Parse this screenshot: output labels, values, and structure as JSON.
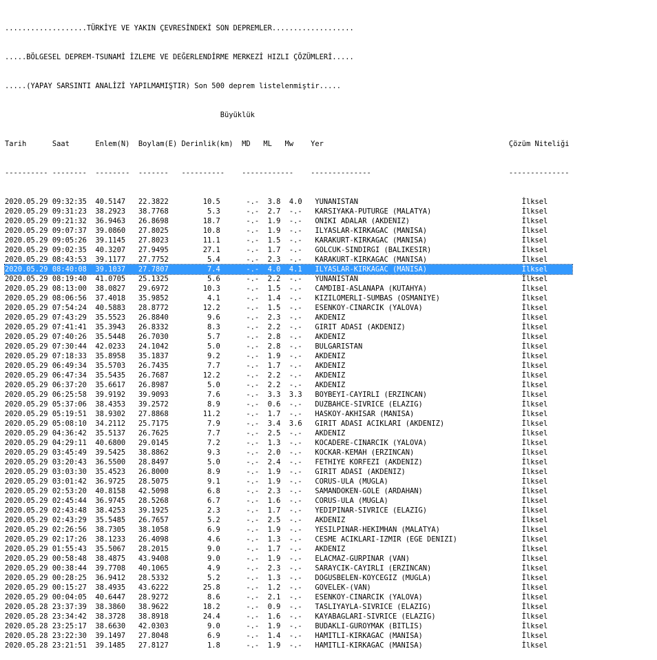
{
  "header": {
    "title_line_1": "...................TÜRKİYE VE YAKIN ÇEVRESİNDEKİ SON DEPREMLER...................",
    "title_line_2": ".....BÖLGESEL DEPREM-TSUNAMİ İZLEME VE DEĞERLENDİRME MERKEZİ HIZLI ÇÖZÜMLERİ.....",
    "title_line_3": ".....(YAPAY SARSINTI ANALİZİ YAPILMAMIŞTIR) Son 500 deprem listelenmiştir.....",
    "magnitude_group_label": "                                                  Büyüklük",
    "column_header_line": "Tarih      Saat      Enlem(N)  Boylam(E) Derinlik(km)  MD   ML   Mw    Yer                                           Çözüm Niteliği",
    "separator_line": "---------- --------  --------  -------   ----------    ------------    --------------                                --------------"
  },
  "selected_index": 7,
  "rows": [
    {
      "text": "2020.05.29 09:32:35  40.5147   22.3822        10.5      -.-  3.8  4.0   YUNANISTAN                                      İlksel"
    },
    {
      "text": "2020.05.29 09:31:23  38.2923   38.7768         5.3      -.-  2.7  -.-   KARSIYAKA-PUTURGE (MALATYA)                     İlksel"
    },
    {
      "text": "2020.05.29 09:21:32  36.9463   26.8698        18.7      -.-  1.9  -.-   ONIKI ADALAR (AKDENIZ)                          İlksel"
    },
    {
      "text": "2020.05.29 09:07:37  39.0860   27.8025        10.8      -.-  1.9  -.-   ILYASLAR-KIRKAGAC (MANISA)                      İlksel"
    },
    {
      "text": "2020.05.29 09:05:26  39.1145   27.8023        11.1      -.-  1.5  -.-   KARAKURT-KIRKAGAC (MANISA)                      İlksel"
    },
    {
      "text": "2020.05.29 09:02:35  40.3207   27.9495        27.1      -.-  1.7  -.-   GOLCUK-SINDIRGI (BALIKESIR)                     İlksel"
    },
    {
      "text": "2020.05.29 08:43:53  39.1177   27.7752         5.4      -.-  2.3  -.-   KARAKURT-KIRKAGAC (MANISA)                      İlksel"
    },
    {
      "text": "2020.05.29 08:40:08  39.1037   27.7807         7.4      -.-  4.0  4.1   ILYASLAR-KIRKAGAC (MANISA)                      İlksel"
    },
    {
      "text": "2020.05.29 08:19:40  41.0705   25.1325         5.6      -.-  2.2  -.-   YUNANISTAN                                      İlksel"
    },
    {
      "text": "2020.05.29 08:13:00  38.0827   29.6972        10.3      -.-  1.5  -.-   CAMDIBI-ASLANAPA (KUTAHYA)                      İlksel"
    },
    {
      "text": "2020.05.29 08:06:56  37.4018   35.9852         4.1      -.-  1.4  -.-   KIZILOMERLI-SUMBAS (OSMANIYE)                   İlksel"
    },
    {
      "text": "2020.05.29 07:54:24  40.5883   28.8772        12.2      -.-  1.5  -.-   ESENKOY-CINARCIK (YALOVA)                       İlksel"
    },
    {
      "text": "2020.05.29 07:43:29  35.5523   26.8840         9.6      -.-  2.3  -.-   AKDENIZ                                         İlksel"
    },
    {
      "text": "2020.05.29 07:41:41  35.3943   26.8332         8.3      -.-  2.2  -.-   GIRIT ADASI (AKDENIZ)                           İlksel"
    },
    {
      "text": "2020.05.29 07:40:26  35.5448   26.7030         5.7      -.-  2.8  -.-   AKDENIZ                                         İlksel"
    },
    {
      "text": "2020.05.29 07:30:44  42.0233   24.1042         5.0      -.-  2.8  -.-   BULGARISTAN                                     İlksel"
    },
    {
      "text": "2020.05.29 07:18:33  35.8958   35.1837         9.2      -.-  1.9  -.-   AKDENIZ                                         İlksel"
    },
    {
      "text": "2020.05.29 06:49:34  35.5703   26.7435         7.7      -.-  1.7  -.-   AKDENIZ                                         İlksel"
    },
    {
      "text": "2020.05.29 06:47:34  35.5435   26.7687        12.2      -.-  2.2  -.-   AKDENIZ                                         İlksel"
    },
    {
      "text": "2020.05.29 06:37:20  35.6617   26.8987         5.0      -.-  2.2  -.-   AKDENIZ                                         İlksel"
    },
    {
      "text": "2020.05.29 06:25:58  39.9192   39.9093         7.6      -.-  3.3  3.3   BOYBEYI-CAYIRLI (ERZINCAN)                      İlksel"
    },
    {
      "text": "2020.05.29 05:37:06  38.4353   39.2572         8.9      -.-  0.6  -.-   DUZBAHCE-SIVRICE (ELAZIG)                       İlksel"
    },
    {
      "text": "2020.05.29 05:19:51  38.9302   27.8868        11.2      -.-  1.7  -.-   HASKOY-AKHISAR (MANISA)                         İlksel"
    },
    {
      "text": "2020.05.29 05:08:10  34.2112   25.7175         7.9      -.-  3.4  3.6   GIRIT ADASI ACIKLARI (AKDENIZ)                  İlksel"
    },
    {
      "text": "2020.05.29 04:36:42  35.5137   26.7625         7.7      -.-  2.5  -.-   AKDENIZ                                         İlksel"
    },
    {
      "text": "2020.05.29 04:29:11  40.6800   29.0145         7.2      -.-  1.3  -.-   KOCADERE-CINARCIK (YALOVA)                      İlksel"
    },
    {
      "text": "2020.05.29 03:45:49  39.5425   38.8862         9.3      -.-  2.0  -.-   KOCKAR-KEMAH (ERZINCAN)                         İlksel"
    },
    {
      "text": "2020.05.29 03:20:43  36.5500   28.8497         5.0      -.-  2.4  -.-   FETHIYE KORFEZI (AKDENIZ)                       İlksel"
    },
    {
      "text": "2020.05.29 03:03:30  35.4523   26.8000         8.9      -.-  1.9  -.-   GIRIT ADASI (AKDENIZ)                           İlksel"
    },
    {
      "text": "2020.05.29 03:01:42  36.9725   28.5075         9.1      -.-  1.9  -.-   CORUS-ULA (MUGLA)                               İlksel"
    },
    {
      "text": "2020.05.29 02:53:20  40.8158   42.5098         6.8      -.-  2.3  -.-   SAMANDOKEN-GOLE (ARDAHAN)                       İlksel"
    },
    {
      "text": "2020.05.29 02:45:44  36.9745   28.5268         6.7      -.-  1.6  -.-   CORUS-ULA (MUGLA)                               İlksel"
    },
    {
      "text": "2020.05.29 02:43:48  38.4253   39.1925         2.3      -.-  1.7  -.-   YEDIPINAR-SIVRICE (ELAZIG)                      İlksel"
    },
    {
      "text": "2020.05.29 02:43:29  35.5485   26.7657         5.2      -.-  2.5  -.-   AKDENIZ                                         İlksel"
    },
    {
      "text": "2020.05.29 02:26:56  38.7305   38.1058         6.9      -.-  1.9  -.-   YESILPINAR-HEKIMHAN (MALATYA)                   İlksel"
    },
    {
      "text": "2020.05.29 02:17:26  38.1233   26.4098         4.6      -.-  1.3  -.-   CESME ACIKLARI-IZMIR (EGE DENIZI)               İlksel"
    },
    {
      "text": "2020.05.29 01:55:43  35.5067   28.2015         9.0      -.-  1.7  -.-   AKDENIZ                                         İlksel"
    },
    {
      "text": "2020.05.29 00:58:48  38.4875   43.9408         9.0      -.-  1.9  -.-   ELACMAZ-GURPINAR (VAN)                          İlksel"
    },
    {
      "text": "2020.05.29 00:38:44  39.7708   40.1065         4.9      -.-  2.3  -.-   SARAYCIK-CAYIRLI (ERZINCAN)                     İlksel"
    },
    {
      "text": "2020.05.29 00:28:25  36.9412   28.5332         5.2      -.-  1.3  -.-   DOGUSBELEN-KOYCEGIZ (MUGLA)                     İlksel"
    },
    {
      "text": "2020.05.29 00:15:27  38.4935   43.6222        25.8      -.-  1.2  -.-   GOVELEK-(VAN)                                   İlksel"
    },
    {
      "text": "2020.05.29 00:04:05  40.6447   28.9272         8.6      -.-  2.1  -.-   ESENKOY-CINARCIK (YALOVA)                       İlksel"
    },
    {
      "text": "2020.05.28 23:37:39  38.3860   38.9622        18.2      -.-  0.9  -.-   TASLIYAYLA-SIVRICE (ELAZIG)                     İlksel"
    },
    {
      "text": "2020.05.28 23:34:42  38.3728   38.8918        24.4      -.-  1.6  -.-   KAYABAGLARI-SIVRICE (ELAZIG)                    İlksel"
    },
    {
      "text": "2020.05.28 23:25:17  38.6630   42.0303         9.0      -.-  1.9  -.-   BUDAKLI-GUROYMAK (BITLIS)                       İlksel"
    },
    {
      "text": "2020.05.28 23:22:30  39.1497   27.8048         6.9      -.-  1.4  -.-   HAMITLI-KIRKAGAC (MANISA)                       İlksel"
    },
    {
      "text": "2020.05.28 23:21:51  39.1485   27.8127         1.8      -.-  1.9  -.-   HAMITLI-KIRKAGAC (MANISA)                       İlksel"
    }
  ]
}
